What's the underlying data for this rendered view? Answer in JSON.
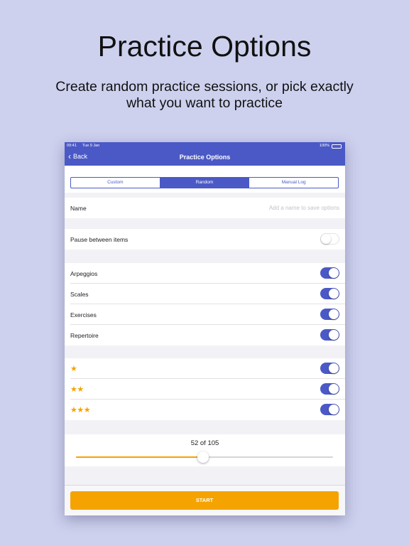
{
  "hero": {
    "title": "Practice Options",
    "subtitle": "Create random practice sessions, or pick exactly what you want to practice"
  },
  "status_bar": {
    "time": "09:41",
    "date": "Tue 9 Jan",
    "battery": "100%"
  },
  "nav": {
    "back_label": "Back",
    "title": "Practice Options"
  },
  "segments": [
    "Custom",
    "Random",
    "Manual Log"
  ],
  "selected_segment": "Random",
  "name_field": {
    "label": "Name",
    "value": "",
    "placeholder": "Add a name to save options"
  },
  "pause_row": {
    "label": "Pause between items",
    "enabled": false
  },
  "categories": [
    {
      "label": "Arpeggios",
      "enabled": true
    },
    {
      "label": "Scales",
      "enabled": true
    },
    {
      "label": "Exercises",
      "enabled": true
    },
    {
      "label": "Repertoire",
      "enabled": true
    }
  ],
  "ratings": [
    {
      "stars": "★",
      "enabled": true
    },
    {
      "stars": "★★",
      "enabled": true
    },
    {
      "stars": "★★★",
      "enabled": true
    }
  ],
  "slider": {
    "text": "52 of 105",
    "value": 52,
    "max": 105
  },
  "start_label": "START",
  "colors": {
    "background": "#cdd1ee",
    "accent": "#4b59c6",
    "orange": "#f5a300",
    "battery": "#5ed35e"
  }
}
